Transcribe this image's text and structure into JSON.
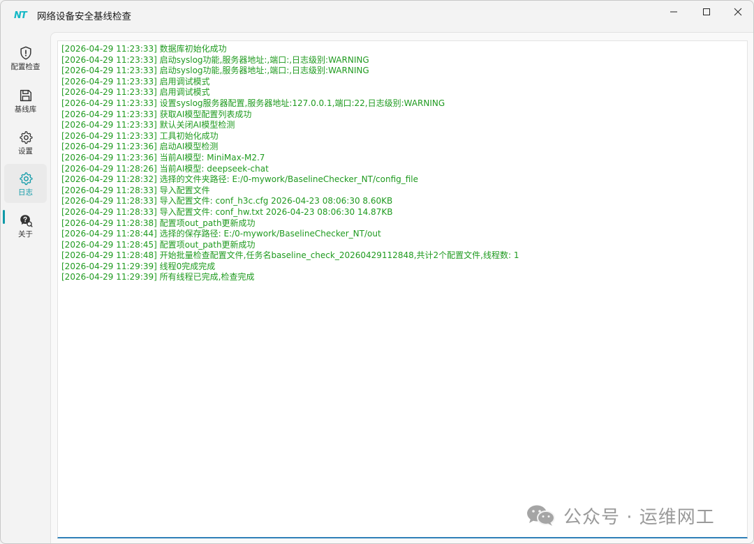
{
  "window": {
    "logo_text": "NT",
    "title": "网络设备安全基线检查",
    "controls": [
      "minimize",
      "maximize",
      "close"
    ]
  },
  "sidebar": {
    "items": [
      {
        "label": "配置检查",
        "icon": "shield-icon",
        "active": false
      },
      {
        "label": "基线库",
        "icon": "save-icon",
        "active": false
      },
      {
        "label": "设置",
        "icon": "gear-icon",
        "active": false
      },
      {
        "label": "日志",
        "icon": "gear-icon",
        "active": true
      },
      {
        "label": "关于",
        "icon": "help-chat-icon",
        "active": false
      }
    ]
  },
  "log": {
    "lines": [
      "[2026-04-29 11:23:33] 数据库初始化成功",
      "[2026-04-29 11:23:33] 启动syslog功能,服务器地址:,端口:,日志级别:WARNING",
      "[2026-04-29 11:23:33] 启动syslog功能,服务器地址:,端口:,日志级别:WARNING",
      "[2026-04-29 11:23:33] 启用调试模式",
      "[2026-04-29 11:23:33] 启用调试模式",
      "[2026-04-29 11:23:33] 设置syslog服务器配置,服务器地址:127.0.0.1,端口:22,日志级别:WARNING",
      "[2026-04-29 11:23:33] 获取AI模型配置列表成功",
      "[2026-04-29 11:23:33] 默认关闭AI模型检测",
      "[2026-04-29 11:23:33] 工具初始化成功",
      "[2026-04-29 11:23:36] 启动AI模型检测",
      "[2026-04-29 11:23:36] 当前AI模型: MiniMax-M2.7",
      "[2026-04-29 11:28:26] 当前AI模型: deepseek-chat",
      "[2026-04-29 11:28:32] 选择的文件夹路径: E:/0-mywork/BaselineChecker_NT/config_file",
      "[2026-04-29 11:28:33] 导入配置文件",
      "[2026-04-29 11:28:33] 导入配置文件: conf_h3c.cfg 2026-04-23 08:06:30 8.60KB",
      "[2026-04-29 11:28:33] 导入配置文件: conf_hw.txt 2026-04-23 08:06:30 14.87KB",
      "[2026-04-29 11:28:38] 配置项out_path更新成功",
      "[2026-04-29 11:28:44] 选择的保存路径: E:/0-mywork/BaselineChecker_NT/out",
      "[2026-04-29 11:28:45] 配置项out_path更新成功",
      "[2026-04-29 11:28:48] 开始批量检查配置文件,任务名baseline_check_20260429112848,共计2个配置文件,线程数: 1",
      "[2026-04-29 11:29:39] 线程0完成完成",
      "[2026-04-29 11:29:39] 所有线程已完成,检查完成"
    ],
    "text_color": "#1f9a1f"
  },
  "watermark": {
    "text": "公众号 · 运维网工",
    "icon": "wechat-icon"
  },
  "colors": {
    "accent": "#0f9aa8",
    "logo": "#14b8c6",
    "log_border_bottom": "#2f80b8"
  }
}
